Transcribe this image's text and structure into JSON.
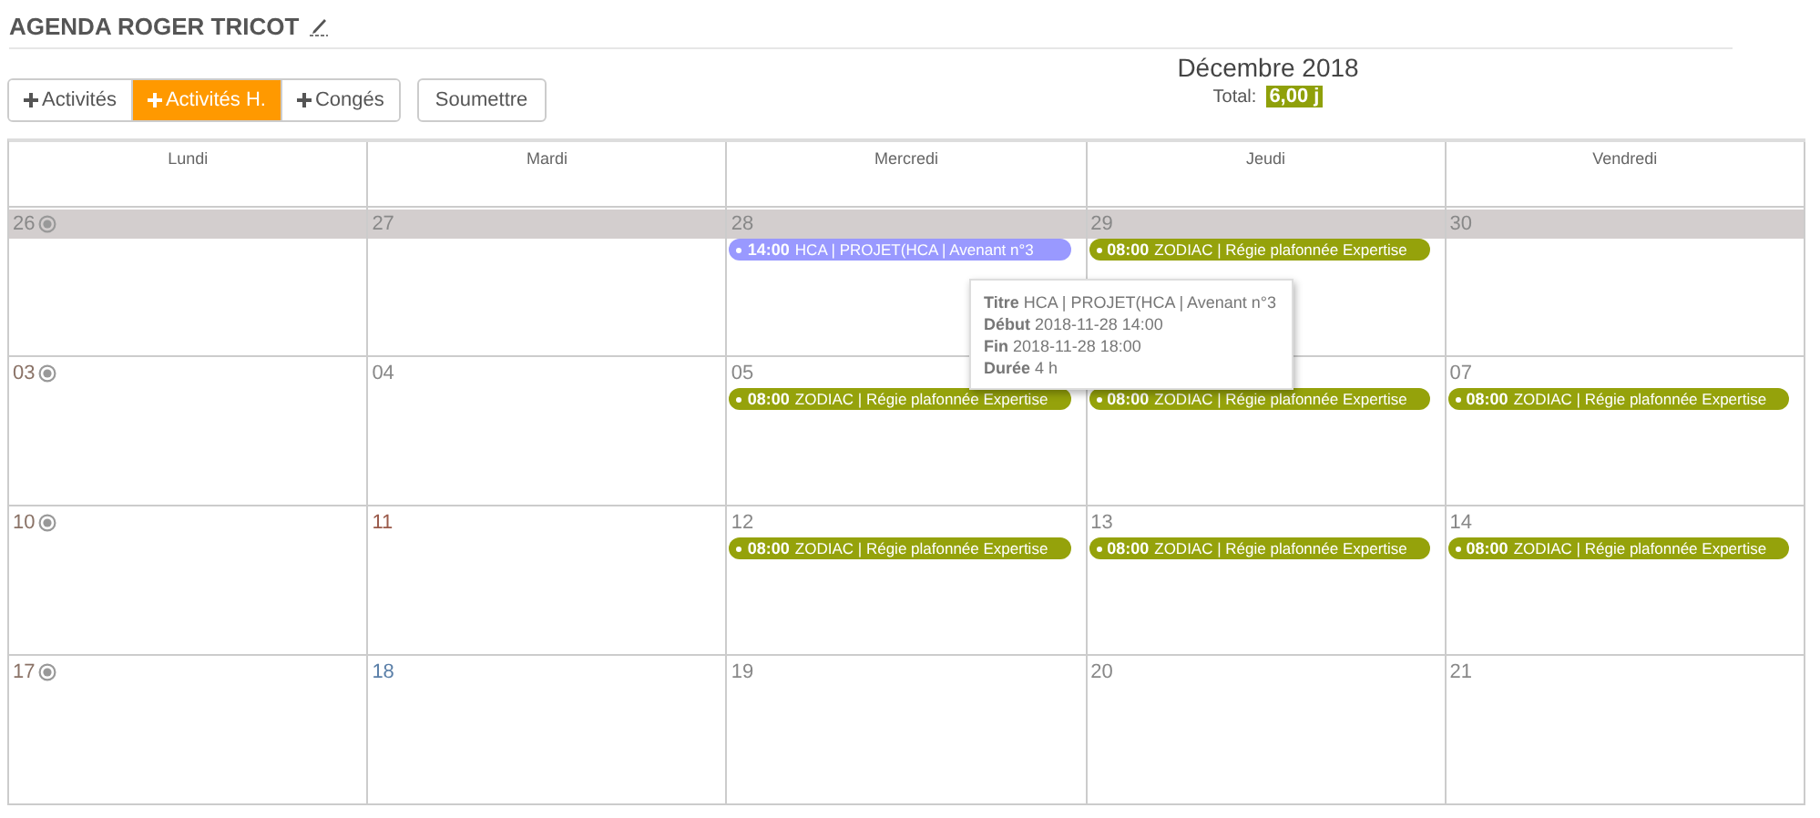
{
  "header": {
    "title": "AGENDA ROGER TRICOT"
  },
  "tabs": [
    {
      "label": "Activités",
      "selected": false
    },
    {
      "label": "Activités H.",
      "selected": true
    },
    {
      "label": "Congés",
      "selected": false
    }
  ],
  "submit_button": "Soumettre",
  "month": "Décembre 2018",
  "total": {
    "label": "Total:",
    "value": "6,00 j"
  },
  "weekdays": [
    "Lundi",
    "Mardi",
    "Mercredi",
    "Jeudi",
    "Vendredi"
  ],
  "weeks": [
    {
      "shaded": true,
      "days": [
        {
          "date": "26",
          "color": "#888888",
          "week_marker": true
        },
        {
          "date": "27",
          "color": "#888888"
        },
        {
          "date": "28",
          "color": "#888888",
          "events": [
            {
              "time": "14:00",
              "title": "HCA | PROJET(HCA | Avenant n°3",
              "color": "#9999ff"
            }
          ]
        },
        {
          "date": "29",
          "color": "#888888",
          "events": [
            {
              "time": "08:00",
              "title": "ZODIAC | Régie plafonnée Expertise",
              "color": "#95a20b"
            }
          ]
        },
        {
          "date": "30",
          "color": "#888888"
        }
      ]
    },
    {
      "days": [
        {
          "date": "03",
          "color": "#8a7266",
          "week_marker": true
        },
        {
          "date": "04",
          "color": "#888888"
        },
        {
          "date": "05",
          "color": "#888888",
          "events": [
            {
              "time": "08:00",
              "title": "ZODIAC | Régie plafonnée Expertise",
              "color": "#95a20b"
            }
          ]
        },
        {
          "events": [
            {
              "time": "08:00",
              "title": "ZODIAC | Régie plafonnée Expertise",
              "color": "#95a20b"
            }
          ]
        },
        {
          "date": "07",
          "color": "#888888",
          "events": [
            {
              "time": "08:00",
              "title": "ZODIAC | Régie plafonnée Expertise",
              "color": "#95a20b"
            }
          ]
        }
      ]
    },
    {
      "days": [
        {
          "date": "10",
          "color": "#8a7266",
          "week_marker": true
        },
        {
          "date": "11",
          "color": "#9a5a4a"
        },
        {
          "date": "12",
          "color": "#888888",
          "events": [
            {
              "time": "08:00",
              "title": "ZODIAC | Régie plafonnée Expertise",
              "color": "#95a20b"
            }
          ]
        },
        {
          "date": "13",
          "color": "#888888",
          "events": [
            {
              "time": "08:00",
              "title": "ZODIAC | Régie plafonnée Expertise",
              "color": "#95a20b"
            }
          ]
        },
        {
          "date": "14",
          "color": "#888888",
          "events": [
            {
              "time": "08:00",
              "title": "ZODIAC | Régie plafonnée Expertise",
              "color": "#95a20b"
            }
          ]
        }
      ]
    },
    {
      "days": [
        {
          "date": "17",
          "color": "#8a7266",
          "week_marker": true
        },
        {
          "date": "18",
          "color": "#5a7fa8"
        },
        {
          "date": "19",
          "color": "#888888"
        },
        {
          "date": "20",
          "color": "#888888"
        },
        {
          "date": "21",
          "color": "#888888"
        }
      ]
    }
  ],
  "tooltip": {
    "rows": [
      {
        "label": "Titre",
        "value": "HCA | PROJET(HCA | Avenant n°3"
      },
      {
        "label": "Début",
        "value": "2018-11-28 14:00"
      },
      {
        "label": "Fin",
        "value": "2018-11-28 18:00"
      },
      {
        "label": "Durée",
        "value": "4 h"
      }
    ]
  }
}
